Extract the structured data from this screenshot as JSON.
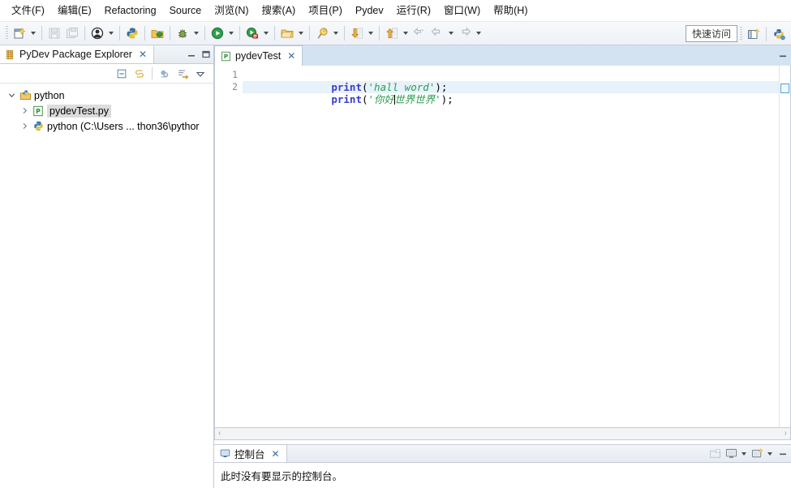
{
  "menubar": {
    "items": [
      {
        "text": "文件(F)",
        "mnemonic": "F"
      },
      {
        "text": "编辑(E)",
        "mnemonic": "E"
      },
      {
        "text": "Refactoring",
        "mnemonic": "t"
      },
      {
        "text": "Source",
        "mnemonic": "S"
      },
      {
        "text": "浏览(N)",
        "mnemonic": "N"
      },
      {
        "text": "搜索(A)",
        "mnemonic": "A"
      },
      {
        "text": "项目(P)",
        "mnemonic": "P"
      },
      {
        "text": "Pydev",
        "mnemonic": "y"
      },
      {
        "text": "运行(R)",
        "mnemonic": "R"
      },
      {
        "text": "窗口(W)",
        "mnemonic": "W"
      },
      {
        "text": "帮助(H)",
        "mnemonic": "H"
      }
    ]
  },
  "toolbar": {
    "buttons": [
      {
        "name": "new-wizard-icon",
        "arrow": true
      },
      {
        "name": "save-icon",
        "arrow": false
      },
      {
        "name": "save-all-icon",
        "arrow": false
      },
      {
        "name": "user-profile-icon",
        "arrow": true
      },
      {
        "name": "pydev-python-icon",
        "arrow": false
      },
      {
        "name": "pydev-package-icon",
        "arrow": false
      },
      {
        "name": "debug-icon",
        "arrow": true
      },
      {
        "name": "run-icon",
        "arrow": true
      },
      {
        "name": "external-tools-icon",
        "arrow": true
      },
      {
        "name": "open-type-icon",
        "arrow": true
      },
      {
        "name": "open-resource-icon",
        "arrow": false
      },
      {
        "name": "search-icon",
        "arrow": true
      },
      {
        "name": "next-annotation-icon",
        "arrow": true
      },
      {
        "name": "previous-annotation-icon",
        "arrow": true
      },
      {
        "name": "last-edit-location-icon",
        "arrow": false
      },
      {
        "name": "back-icon",
        "arrow": true
      },
      {
        "name": "forward-icon",
        "arrow": true
      }
    ],
    "quick_access_label": "快速访问",
    "right_buttons": [
      {
        "name": "open-perspective-icon"
      },
      {
        "name": "pydev-perspective-icon"
      }
    ]
  },
  "package_explorer": {
    "tab_title": "PyDev Package Explorer",
    "tab_icon": "pydev-package-explorer-icon",
    "close_glyph": "✕",
    "view_controls": [
      {
        "name": "minimize-view-button",
        "glyph": "minimize"
      },
      {
        "name": "maximize-view-button",
        "glyph": "maximize"
      }
    ],
    "toolbar_buttons": [
      {
        "name": "collapse-all-button"
      },
      {
        "name": "link-with-editor-button"
      },
      {
        "name": "filter-button"
      },
      {
        "name": "sort-button"
      },
      {
        "name": "view-menu-button"
      }
    ],
    "tree": [
      {
        "label": "python",
        "icon": "python-project-icon",
        "indent": 0,
        "twisty": "expanded",
        "selected": false
      },
      {
        "label": "pydevTest.py",
        "icon": "python-file-icon",
        "indent": 1,
        "twisty": "collapsed",
        "selected": true
      },
      {
        "label": "python  (C:\\Users ... thon36\\pythor",
        "icon": "python-interpreter-icon",
        "indent": 1,
        "twisty": "collapsed",
        "selected": false
      }
    ]
  },
  "editor": {
    "tab_title": "pydevTest",
    "tab_icon": "python-file-icon",
    "close_glyph": "✕",
    "minimize_button": "minimize-editor-button",
    "line_numbers": [
      "1",
      "2"
    ],
    "lines": [
      {
        "number": "1",
        "current": false,
        "tokens": [
          {
            "type": "kw",
            "text": "print"
          },
          {
            "type": "pn",
            "text": "("
          },
          {
            "type": "str",
            "text": "'hall word'"
          },
          {
            "type": "pn",
            "text": ");"
          }
        ]
      },
      {
        "number": "2",
        "current": true,
        "tokens": [
          {
            "type": "kw",
            "text": "print"
          },
          {
            "type": "pn",
            "text": "("
          },
          {
            "type": "str",
            "text": "'你好"
          },
          {
            "type": "caret",
            "text": ""
          },
          {
            "type": "str",
            "text": "世界世界'"
          },
          {
            "type": "pn",
            "text": ");"
          }
        ]
      }
    ],
    "hscroll": {
      "left_glyph": "‹",
      "right_glyph": "›"
    }
  },
  "console": {
    "tab_title": "控制台",
    "tab_icon": "console-icon",
    "close_glyph": "✕",
    "message": "此时没有要显示的控制台。",
    "toolbar_buttons": [
      {
        "name": "open-console-icon"
      },
      {
        "name": "display-selected-console-icon",
        "arrow": true
      },
      {
        "name": "new-console-view-icon",
        "arrow": true
      },
      {
        "name": "minimize-console-button"
      }
    ]
  },
  "colors": {
    "accent": "#3b3bcd",
    "string": "#2a9d4e",
    "current_line": "#e8f2fb",
    "tab_active": "#d4e3f2",
    "selection": "#dcdcdc"
  }
}
